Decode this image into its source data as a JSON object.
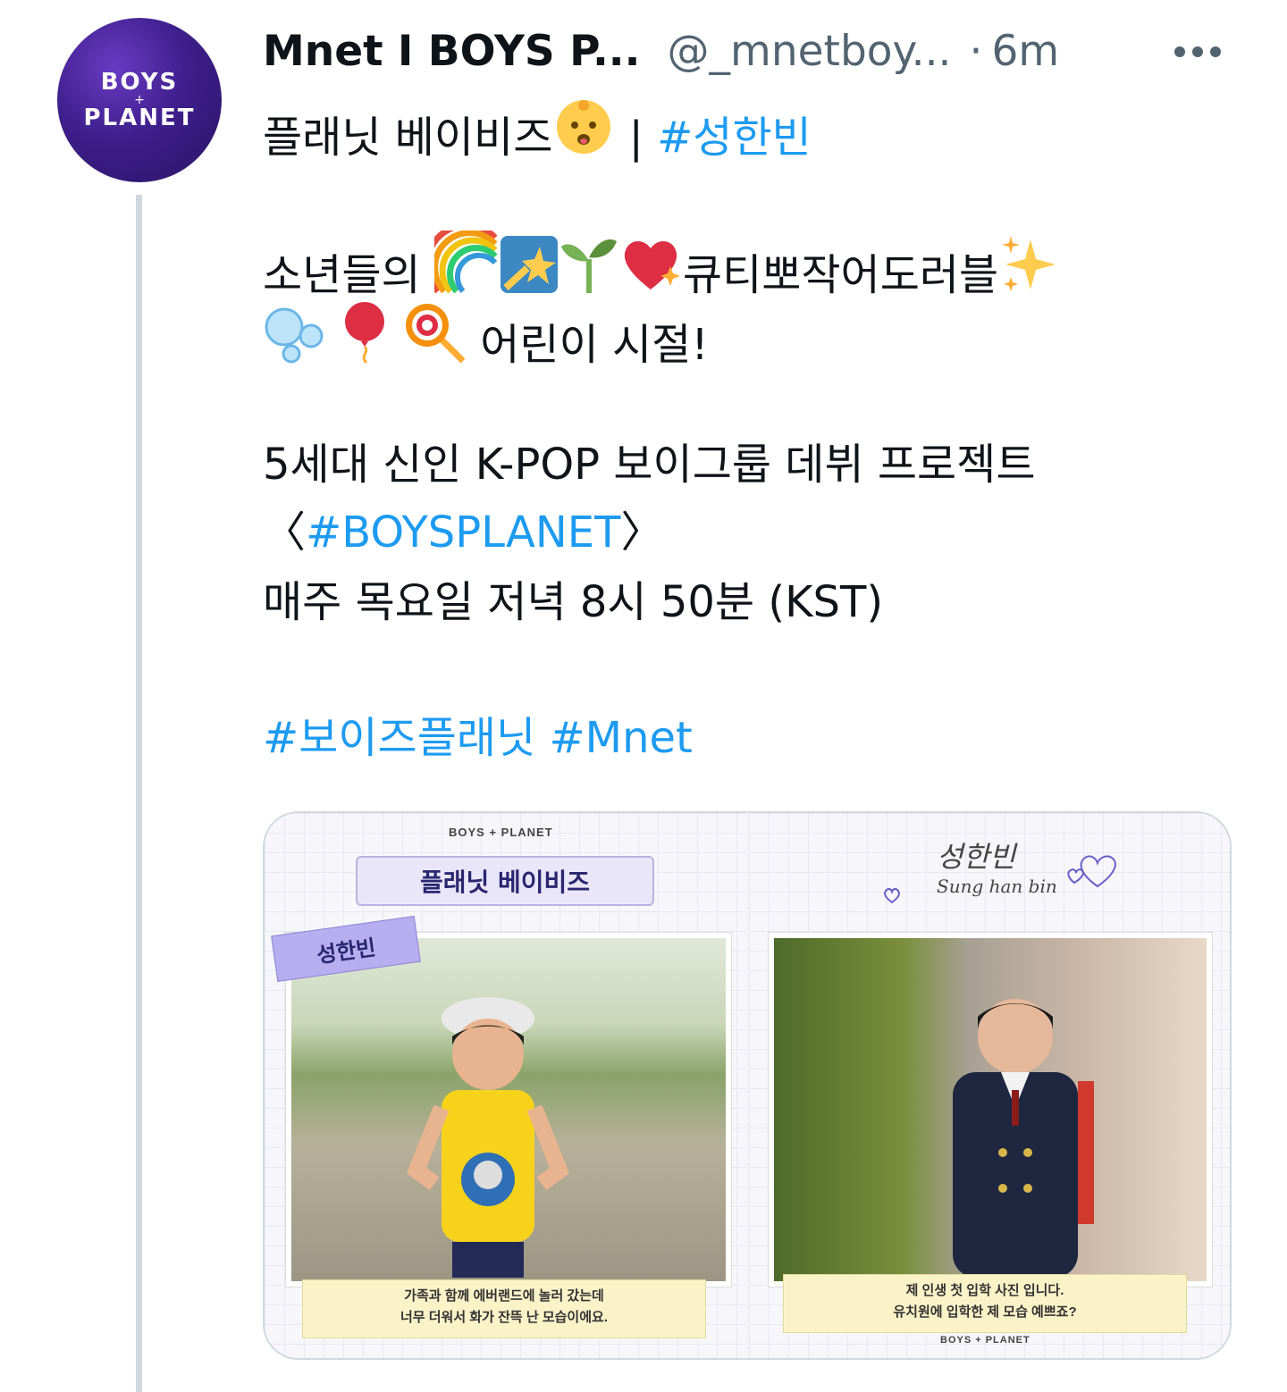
{
  "account": {
    "avatar_line1": "BOYS",
    "avatar_line2": "+",
    "avatar_line3": "PLANET",
    "display_name": "Mnet I BOYS P...",
    "handle": "@_mnetboy...",
    "separator": "·",
    "time": "6m"
  },
  "tweet": {
    "line1_text": "플래닛 베이비즈",
    "line1_sep": " | ",
    "line1_tag": "#성한빈",
    "line2_prefix": "소년들의 ",
    "line2_mid": "큐티뽀작어도러블",
    "line3_suffix": " 어린이 시절!",
    "line4": "5세대 신인 K-POP 보이그룹 데뷔 프로젝트",
    "line5_open": "〈",
    "line5_tag": "#BOYSPLANET",
    "line5_close": "〉",
    "line6": "매주 목요일 저녁 8시 50분 (KST)",
    "tag1": "#보이즈플래닛",
    "tag2": "#Mnet"
  },
  "emoji": {
    "baby": "baby-icon",
    "rainbow": "rainbow-icon",
    "shooting_star": "shooting-star-icon",
    "seedling": "seedling-icon",
    "sparkling_heart": "sparkling-heart-icon",
    "sparkles": "sparkles-icon",
    "bubbles": "bubbles-icon",
    "balloon": "balloon-icon",
    "lollipop": "lollipop-icon"
  },
  "media": {
    "panel1_logo": "BOYS + PLANET",
    "panel1_title": "플래닛 베이비즈",
    "panel1_name": "성한빈",
    "panel1_caption1": "가족과 함께 에버랜드에 놀러 갔는데",
    "panel1_caption2": "너무 더워서 화가 잔뜩 난 모습이에요.",
    "panel2_sign_ko": "성한빈",
    "panel2_sign_en": "Sung han bin",
    "panel2_caption1": "제 인생 첫 입학 사진 입니다.",
    "panel2_caption2": "유치원에 입학한 제 모습 예쁘죠?",
    "panel2_logo": "BOYS + PLANET"
  },
  "colors": {
    "link": "#1d9bf0",
    "text": "#0f1419",
    "muted": "#536471",
    "avatar_bg": "#3f1f8c",
    "thread_line": "#cfd9de"
  }
}
